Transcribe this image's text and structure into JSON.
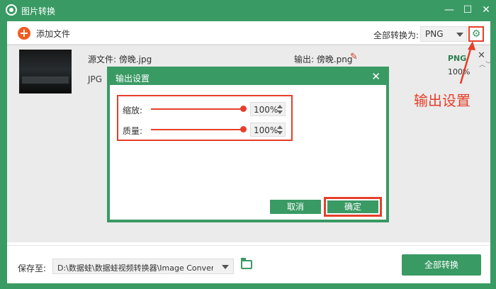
{
  "window": {
    "title": "图片转换",
    "minimize": "—",
    "maximize": "☐",
    "close": "✕"
  },
  "toolbar": {
    "add_files_label": "添加文件",
    "plus_glyph": "+",
    "convert_all_to_label": "全部转换为:",
    "format_value": "PNG",
    "gear_glyph": "⚙"
  },
  "file_row": {
    "source_label": "源文件: 傍晚.jpg",
    "source_format": "JPG",
    "output_label": "输出: 傍晚.png",
    "edit_glyph": "✎",
    "output_format": "PNG",
    "output_percent": "100%",
    "close_glyph": "✕",
    "stepper_glyph": "︿﹀"
  },
  "annotation": {
    "text": "输出设置",
    "color": "#e53f2a"
  },
  "dialog": {
    "title": "输出设置",
    "close_glyph": "✕",
    "settings": [
      {
        "label": "缩放:",
        "value": "100%",
        "level": 1.0
      },
      {
        "label": "质量:",
        "value": "100%",
        "level": 1.0
      }
    ],
    "cancel_label": "取消",
    "ok_label": "确定"
  },
  "bottombar": {
    "save_to_label": "保存至:",
    "save_path": "D:\\数据蛙\\数据蛙视频转换器\\Image Converter",
    "convert_all_label": "全部转换"
  },
  "colors": {
    "brand_green": "#3a9a64",
    "accent_orange": "#f25c1f",
    "annotation_red": "#e53f2a"
  }
}
